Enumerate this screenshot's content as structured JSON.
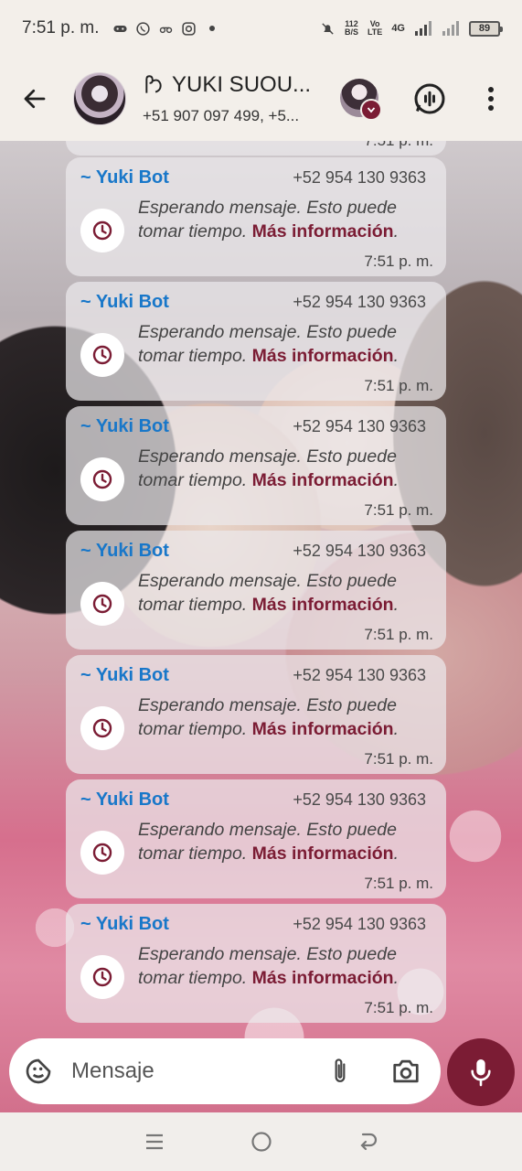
{
  "status_bar": {
    "time": "7:51 p. m.",
    "net_speed_top": "112",
    "net_speed_bottom": "B/S",
    "volte_top": "Vo",
    "volte_bottom": "LTE",
    "network": "4G",
    "battery": "89"
  },
  "header": {
    "title": "YUKI SUOU...",
    "subtitle": "+51 907 097 499, +5..."
  },
  "chat": {
    "partial_bubble_time": "7:51 p. m.",
    "messages": [
      {
        "sender": "~ Yuki Bot",
        "phone": "+52 954 130 9363",
        "text": "Esperando mensaje. Esto puede tomar tiempo.",
        "link": "Más información",
        "end": ".",
        "time": "7:51 p. m."
      },
      {
        "sender": "~ Yuki Bot",
        "phone": "+52 954 130 9363",
        "text": "Esperando mensaje. Esto puede tomar tiempo.",
        "link": "Más información",
        "end": ".",
        "time": "7:51 p. m."
      },
      {
        "sender": "~ Yuki Bot",
        "phone": "+52 954 130 9363",
        "text": "Esperando mensaje. Esto puede tomar tiempo.",
        "link": "Más información",
        "end": ".",
        "time": "7:51 p. m."
      },
      {
        "sender": "~ Yuki Bot",
        "phone": "+52 954 130 9363",
        "text": "Esperando mensaje. Esto puede tomar tiempo.",
        "link": "Más información",
        "end": ".",
        "time": "7:51 p. m."
      },
      {
        "sender": "~ Yuki Bot",
        "phone": "+52 954 130 9363",
        "text": "Esperando mensaje. Esto puede tomar tiempo.",
        "link": "Más información",
        "end": ".",
        "time": "7:51 p. m."
      },
      {
        "sender": "~ Yuki Bot",
        "phone": "+52 954 130 9363",
        "text": "Esperando mensaje. Esto puede tomar tiempo.",
        "link": "Más información",
        "end": ".",
        "time": "7:51 p. m."
      },
      {
        "sender": "~ Yuki Bot",
        "phone": "+52 954 130 9363",
        "text": "Esperando mensaje. Esto puede tomar tiempo.",
        "link": "Más información",
        "end": ".",
        "time": "7:51 p. m."
      }
    ]
  },
  "input": {
    "placeholder": "Mensaje"
  },
  "colors": {
    "accent": "#7b1c34",
    "sender_name": "#1877c9"
  },
  "icons": {
    "back": "arrow-left-icon",
    "call": "voice-chat-icon",
    "more": "more-vertical-icon",
    "pending": "clock-icon",
    "sticker": "sticker-icon",
    "attach": "paperclip-icon",
    "camera": "camera-icon",
    "mic": "microphone-icon"
  }
}
